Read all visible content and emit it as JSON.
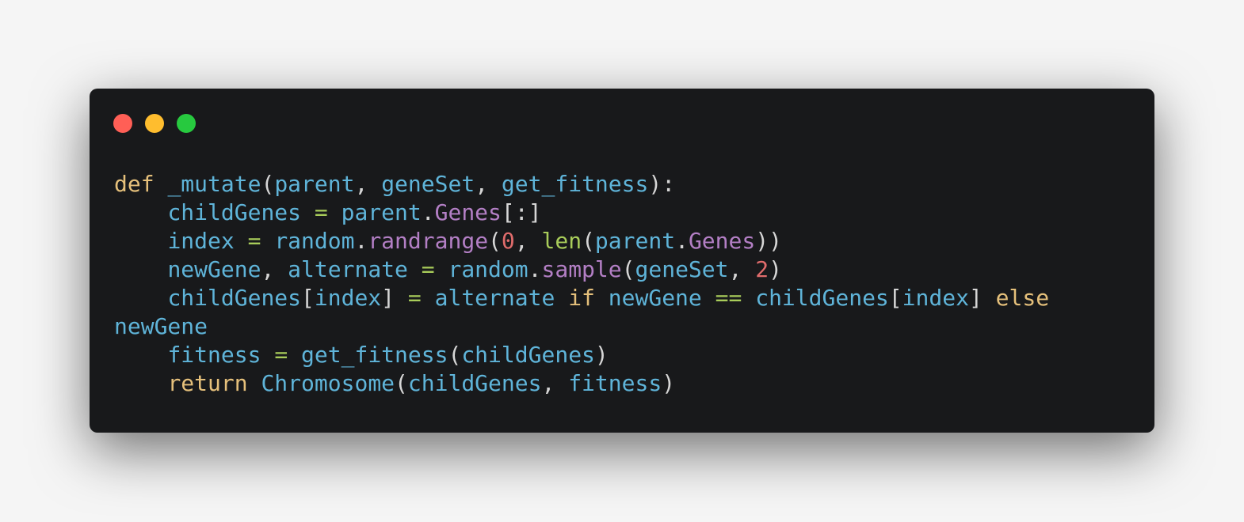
{
  "window_controls": {
    "close_color": "#ff5f56",
    "minimize_color": "#ffbd2e",
    "maximize_color": "#27c93f"
  },
  "palette": {
    "keyword": "#e5c07b",
    "ident": "#5fb4d9",
    "attr": "#b37fc5",
    "number": "#e06c6c",
    "builtin": "#a8cc5a",
    "operator": "#a8cc5a",
    "punct": "#d6d6d6"
  },
  "code": {
    "language": "python",
    "lines": [
      [
        [
          "keyword",
          "def"
        ],
        [
          "punct",
          " "
        ],
        [
          "ident",
          "_mutate"
        ],
        [
          "punct",
          "("
        ],
        [
          "ident",
          "parent"
        ],
        [
          "punct",
          ", "
        ],
        [
          "ident",
          "geneSet"
        ],
        [
          "punct",
          ", "
        ],
        [
          "ident",
          "get_fitness"
        ],
        [
          "punct",
          "):"
        ]
      ],
      [
        [
          "punct",
          "    "
        ],
        [
          "ident",
          "childGenes"
        ],
        [
          "punct",
          " "
        ],
        [
          "operator",
          "="
        ],
        [
          "punct",
          " "
        ],
        [
          "ident",
          "parent"
        ],
        [
          "punct",
          "."
        ],
        [
          "attr",
          "Genes"
        ],
        [
          "punct",
          "[:]"
        ]
      ],
      [
        [
          "punct",
          "    "
        ],
        [
          "ident",
          "index"
        ],
        [
          "punct",
          " "
        ],
        [
          "operator",
          "="
        ],
        [
          "punct",
          " "
        ],
        [
          "ident",
          "random"
        ],
        [
          "punct",
          "."
        ],
        [
          "attr",
          "randrange"
        ],
        [
          "punct",
          "("
        ],
        [
          "number",
          "0"
        ],
        [
          "punct",
          ", "
        ],
        [
          "builtin",
          "len"
        ],
        [
          "punct",
          "("
        ],
        [
          "ident",
          "parent"
        ],
        [
          "punct",
          "."
        ],
        [
          "attr",
          "Genes"
        ],
        [
          "punct",
          "))"
        ]
      ],
      [
        [
          "punct",
          "    "
        ],
        [
          "ident",
          "newGene"
        ],
        [
          "punct",
          ", "
        ],
        [
          "ident",
          "alternate"
        ],
        [
          "punct",
          " "
        ],
        [
          "operator",
          "="
        ],
        [
          "punct",
          " "
        ],
        [
          "ident",
          "random"
        ],
        [
          "punct",
          "."
        ],
        [
          "attr",
          "sample"
        ],
        [
          "punct",
          "("
        ],
        [
          "ident",
          "geneSet"
        ],
        [
          "punct",
          ", "
        ],
        [
          "number",
          "2"
        ],
        [
          "punct",
          ")"
        ]
      ],
      [
        [
          "punct",
          "    "
        ],
        [
          "ident",
          "childGenes"
        ],
        [
          "punct",
          "["
        ],
        [
          "ident",
          "index"
        ],
        [
          "punct",
          "] "
        ],
        [
          "operator",
          "="
        ],
        [
          "punct",
          " "
        ],
        [
          "ident",
          "alternate"
        ],
        [
          "punct",
          " "
        ],
        [
          "keyword",
          "if"
        ],
        [
          "punct",
          " "
        ],
        [
          "ident",
          "newGene"
        ],
        [
          "punct",
          " "
        ],
        [
          "operator",
          "=="
        ],
        [
          "punct",
          " "
        ],
        [
          "ident",
          "childGenes"
        ],
        [
          "punct",
          "["
        ],
        [
          "ident",
          "index"
        ],
        [
          "punct",
          "] "
        ],
        [
          "keyword",
          "else"
        ]
      ],
      [
        [
          "ident",
          "newGene"
        ]
      ],
      [
        [
          "punct",
          "    "
        ],
        [
          "ident",
          "fitness"
        ],
        [
          "punct",
          " "
        ],
        [
          "operator",
          "="
        ],
        [
          "punct",
          " "
        ],
        [
          "ident",
          "get_fitness"
        ],
        [
          "punct",
          "("
        ],
        [
          "ident",
          "childGenes"
        ],
        [
          "punct",
          ")"
        ]
      ],
      [
        [
          "punct",
          "    "
        ],
        [
          "keyword",
          "return"
        ],
        [
          "punct",
          " "
        ],
        [
          "ident",
          "Chromosome"
        ],
        [
          "punct",
          "("
        ],
        [
          "ident",
          "childGenes"
        ],
        [
          "punct",
          ", "
        ],
        [
          "ident",
          "fitness"
        ],
        [
          "punct",
          ")"
        ]
      ]
    ]
  }
}
